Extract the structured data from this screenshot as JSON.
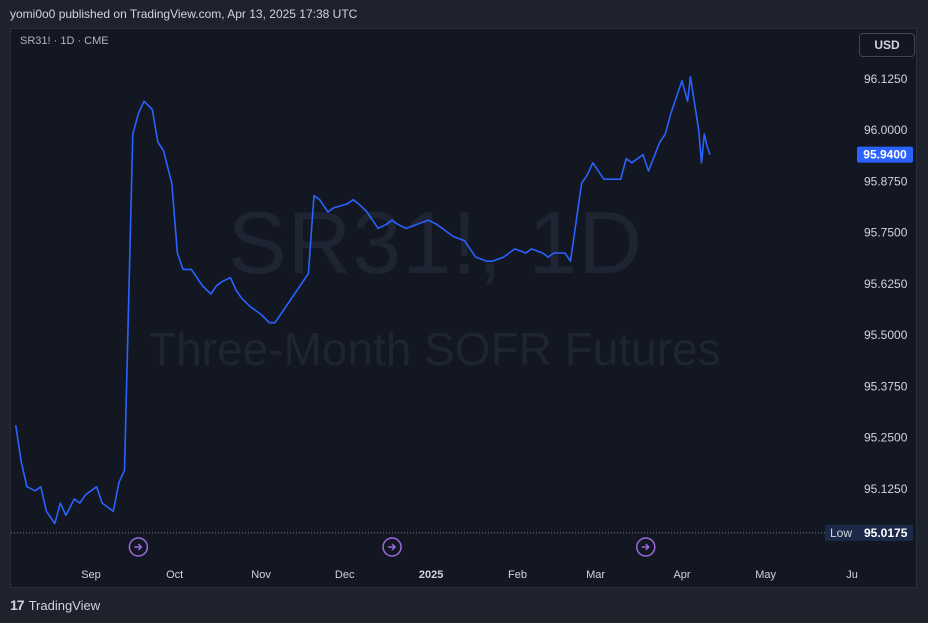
{
  "header": {
    "published_text": "yomi0o0 published on TradingView.com, Apr 13, 2025 17:38 UTC"
  },
  "symbol_label": "SR31! · 1D · CME",
  "currency_button": "USD",
  "watermark": {
    "ticker": "SR31!, 1D",
    "name": "Three-Month SOFR Futures"
  },
  "footer": {
    "brand": "TradingView",
    "logo_glyph": "17"
  },
  "colors": {
    "line": "#2962ff",
    "background": "#131722",
    "price_tag": "#2962ff",
    "low_tag": "#1c2a4a",
    "event_icon": "#9c6ade"
  },
  "chart_data": {
    "type": "line",
    "title": "",
    "xlabel": "",
    "ylabel": "",
    "grid": false,
    "x_tick_labels": [
      "Sep",
      "Oct",
      "Nov",
      "Dec",
      "2025",
      "Feb",
      "Mar",
      "Apr",
      "May",
      "Ju"
    ],
    "y_tick_labels": [
      "96.1250",
      "96.0000",
      "95.8750",
      "95.7500",
      "95.6250",
      "95.5000",
      "95.3750",
      "95.2500",
      "95.1250"
    ],
    "ylim": [
      95.0,
      96.15
    ],
    "last_price_label": "95.9400",
    "low": {
      "label": "Low",
      "value": "95.0175"
    },
    "event_markers": [
      "Sep",
      "Dec",
      "Mar"
    ],
    "series": [
      {
        "x": [
          "2024-08-05",
          "2024-08-07",
          "2024-08-09",
          "2024-08-12",
          "2024-08-14",
          "2024-08-16",
          "2024-08-19",
          "2024-08-21",
          "2024-08-23",
          "2024-08-26",
          "2024-08-28",
          "2024-08-30",
          "2024-09-03",
          "2024-09-05",
          "2024-09-09",
          "2024-09-11",
          "2024-09-13",
          "2024-09-16",
          "2024-09-18",
          "2024-09-20",
          "2024-09-23",
          "2024-09-25",
          "2024-09-27",
          "2024-09-30",
          "2024-10-02",
          "2024-10-04",
          "2024-10-07",
          "2024-10-09",
          "2024-10-11",
          "2024-10-14",
          "2024-10-16",
          "2024-10-18",
          "2024-10-21",
          "2024-10-23",
          "2024-10-25",
          "2024-10-28",
          "2024-10-30",
          "2024-11-01",
          "2024-11-04",
          "2024-11-06",
          "2024-11-08",
          "2024-11-11",
          "2024-11-13",
          "2024-11-15",
          "2024-11-18",
          "2024-11-20",
          "2024-11-22",
          "2024-11-25",
          "2024-11-27",
          "2024-12-02",
          "2024-12-04",
          "2024-12-06",
          "2024-12-09",
          "2024-12-11",
          "2024-12-13",
          "2024-12-16",
          "2024-12-18",
          "2024-12-20",
          "2024-12-23",
          "2024-12-27",
          "2024-12-31",
          "2025-01-03",
          "2025-01-07",
          "2025-01-09",
          "2025-01-13",
          "2025-01-15",
          "2025-01-17",
          "2025-01-21",
          "2025-01-23",
          "2025-01-27",
          "2025-01-29",
          "2025-01-31",
          "2025-02-04",
          "2025-02-06",
          "2025-02-10",
          "2025-02-12",
          "2025-02-14",
          "2025-02-18",
          "2025-02-20",
          "2025-02-24",
          "2025-02-26",
          "2025-02-28",
          "2025-03-04",
          "2025-03-06",
          "2025-03-10",
          "2025-03-12",
          "2025-03-14",
          "2025-03-18",
          "2025-03-20",
          "2025-03-24",
          "2025-03-26",
          "2025-03-28",
          "2025-04-01",
          "2025-04-03",
          "2025-04-04",
          "2025-04-07",
          "2025-04-08",
          "2025-04-09",
          "2025-04-10",
          "2025-04-11"
        ],
        "values": [
          95.28,
          95.19,
          95.13,
          95.12,
          95.13,
          95.07,
          95.04,
          95.09,
          95.06,
          95.1,
          95.09,
          95.11,
          95.13,
          95.09,
          95.07,
          95.14,
          95.17,
          95.99,
          96.04,
          96.07,
          96.05,
          95.97,
          95.95,
          95.87,
          95.7,
          95.66,
          95.66,
          95.64,
          95.62,
          95.6,
          95.62,
          95.63,
          95.64,
          95.61,
          95.59,
          95.57,
          95.56,
          95.55,
          95.53,
          95.53,
          95.55,
          95.58,
          95.6,
          95.62,
          95.65,
          95.84,
          95.83,
          95.8,
          95.81,
          95.82,
          95.83,
          95.82,
          95.8,
          95.78,
          95.76,
          95.77,
          95.78,
          95.77,
          95.76,
          95.77,
          95.78,
          95.77,
          95.75,
          95.74,
          95.73,
          95.71,
          95.69,
          95.68,
          95.68,
          95.69,
          95.7,
          95.71,
          95.7,
          95.71,
          95.7,
          95.69,
          95.7,
          95.7,
          95.68,
          95.87,
          95.89,
          95.92,
          95.88,
          95.88,
          95.88,
          95.93,
          95.92,
          95.94,
          95.9,
          95.97,
          95.99,
          96.04,
          96.12,
          96.07,
          96.13,
          96.0,
          95.92,
          95.99,
          95.96,
          95.94
        ]
      }
    ]
  }
}
